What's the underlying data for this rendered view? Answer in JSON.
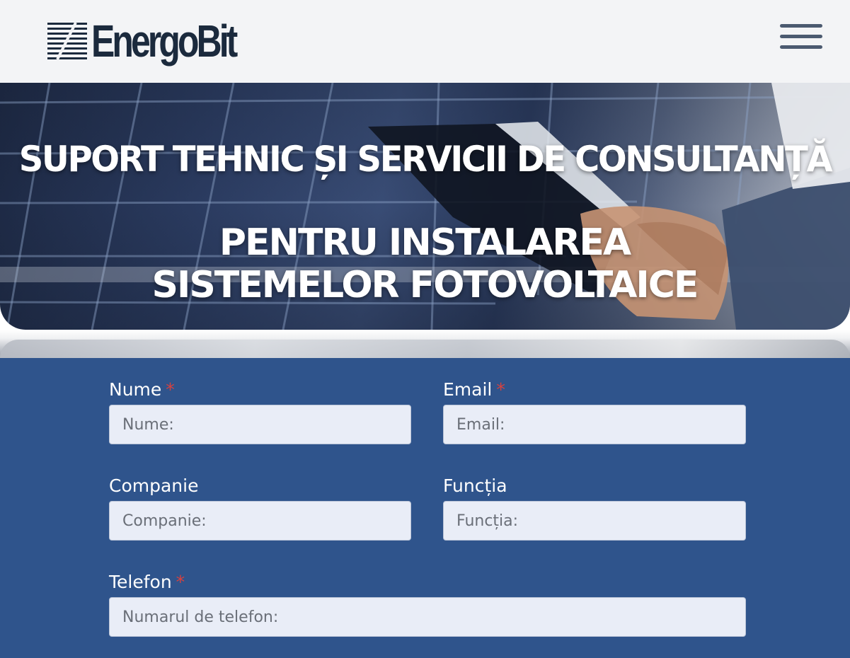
{
  "header": {
    "logo_text": "EnergoBit",
    "logo_icon": "energobit-logo-mark",
    "menu_icon": "hamburger-menu-icon"
  },
  "hero": {
    "line1": "SUPORT TEHNIC ȘI SERVICII DE CONSULTANȚĂ",
    "line2": "PENTRU INSTALAREA SISTEMELOR FOTOVOLTAICE"
  },
  "form": {
    "nume": {
      "label": "Nume",
      "required_mark": "*",
      "placeholder": "Nume:"
    },
    "email": {
      "label": "Email",
      "required_mark": "*",
      "placeholder": "Email:"
    },
    "companie": {
      "label": "Companie",
      "placeholder": "Companie:"
    },
    "functia": {
      "label": "Funcția",
      "placeholder": "Funcția:"
    },
    "telefon": {
      "label": "Telefon",
      "required_mark": "*",
      "placeholder": "Numarul de telefon:"
    }
  },
  "colors": {
    "header_bg": "#f3f4f6",
    "logo": "#1b2a3d",
    "form_bg": "#2f548c",
    "input_bg": "#e9edf7",
    "required": "#d8413e"
  }
}
